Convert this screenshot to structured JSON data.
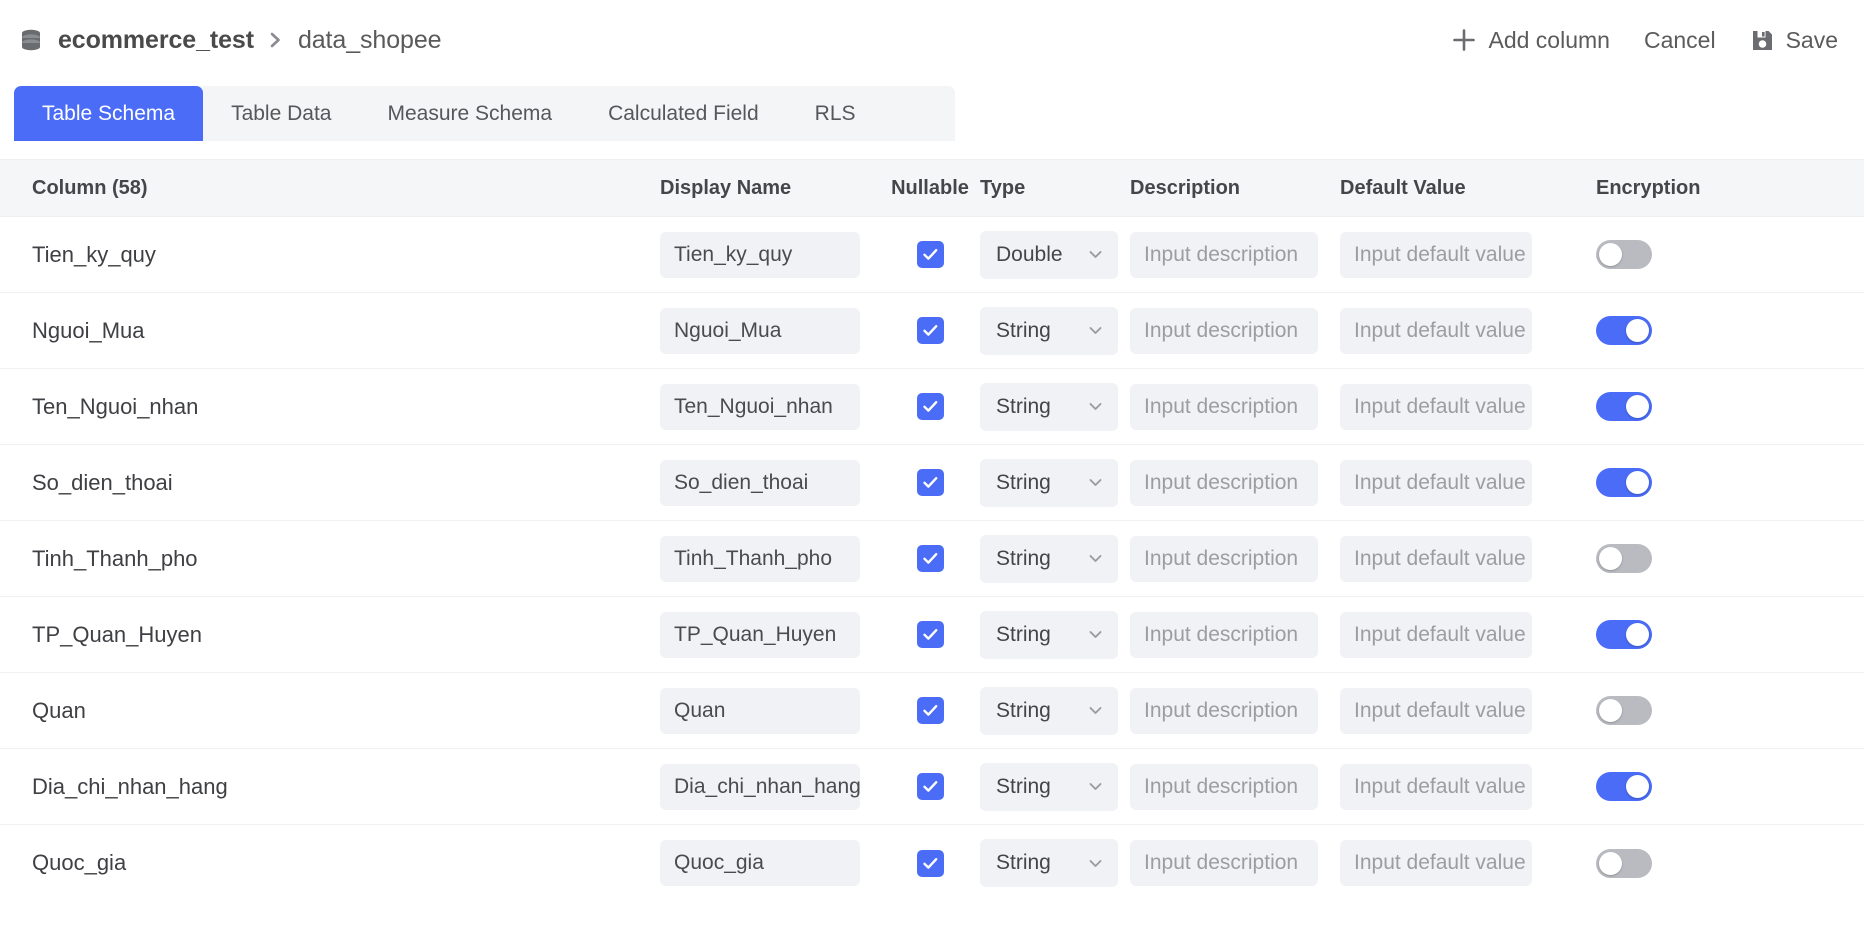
{
  "header": {
    "db_icon": "database-icon",
    "database": "ecommerce_test",
    "separator": "›",
    "table": "data_shopee",
    "actions": {
      "add_column": "Add column",
      "cancel": "Cancel",
      "save": "Save",
      "plus_icon": "plus-icon",
      "save_icon": "floppy-disk-icon"
    }
  },
  "tabs": [
    {
      "label": "Table Schema",
      "active": true
    },
    {
      "label": "Table Data",
      "active": false
    },
    {
      "label": "Measure Schema",
      "active": false
    },
    {
      "label": "Calculated Field",
      "active": false
    },
    {
      "label": "RLS",
      "active": false
    }
  ],
  "table": {
    "columns": [
      "Column (58)",
      "Display Name",
      "Nullable",
      "Type",
      "Description",
      "Default Value",
      "Encryption"
    ],
    "column_count": 58,
    "placeholders": {
      "description": "Input description",
      "default_value": "Input default value"
    },
    "rows": [
      {
        "name": "Tien_ky_quy",
        "display_name": "Tien_ky_quy",
        "nullable": true,
        "type": "Double",
        "description": "",
        "default_value": "",
        "encryption": false
      },
      {
        "name": "Nguoi_Mua",
        "display_name": "Nguoi_Mua",
        "nullable": true,
        "type": "String",
        "description": "",
        "default_value": "",
        "encryption": true
      },
      {
        "name": "Ten_Nguoi_nhan",
        "display_name": "Ten_Nguoi_nhan",
        "nullable": true,
        "type": "String",
        "description": "",
        "default_value": "",
        "encryption": true
      },
      {
        "name": "So_dien_thoai",
        "display_name": "So_dien_thoai",
        "nullable": true,
        "type": "String",
        "description": "",
        "default_value": "",
        "encryption": true
      },
      {
        "name": "Tinh_Thanh_pho",
        "display_name": "Tinh_Thanh_pho",
        "nullable": true,
        "type": "String",
        "description": "",
        "default_value": "",
        "encryption": false
      },
      {
        "name": "TP_Quan_Huyen",
        "display_name": "TP_Quan_Huyen",
        "nullable": true,
        "type": "String",
        "description": "",
        "default_value": "",
        "encryption": true
      },
      {
        "name": "Quan",
        "display_name": "Quan",
        "nullable": true,
        "type": "String",
        "description": "",
        "default_value": "",
        "encryption": false
      },
      {
        "name": "Dia_chi_nhan_hang",
        "display_name": "Dia_chi_nhan_hang",
        "nullable": true,
        "type": "String",
        "description": "",
        "default_value": "",
        "encryption": true
      },
      {
        "name": "Quoc_gia",
        "display_name": "Quoc_gia",
        "nullable": true,
        "type": "String",
        "description": "",
        "default_value": "",
        "encryption": false
      }
    ]
  },
  "colors": {
    "accent": "#4a6cf7",
    "field_bg": "#f1f2f5",
    "header_bg": "#f5f6f8",
    "toggle_off": "#b9bbc0"
  }
}
